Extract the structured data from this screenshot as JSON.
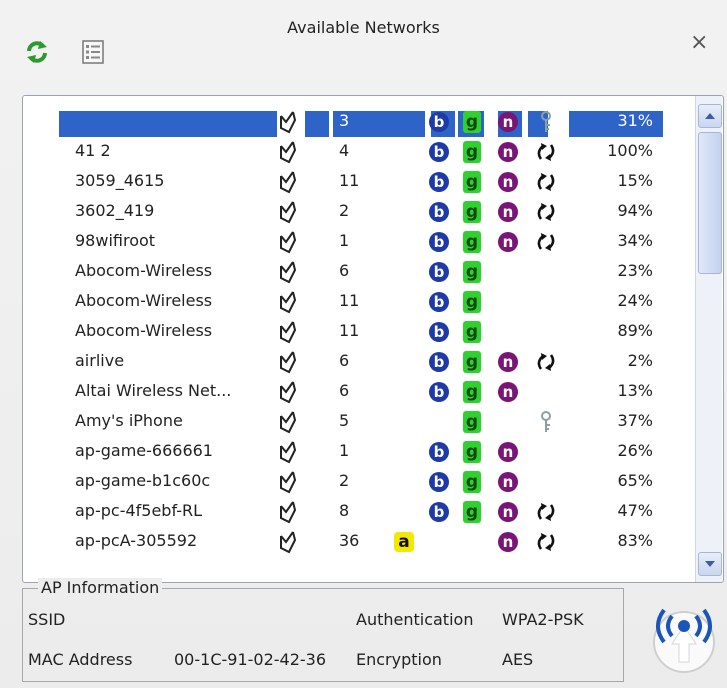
{
  "window": {
    "title": "Available Networks",
    "close": "×"
  },
  "networks": [
    {
      "ssid": "",
      "ch": "3",
      "b": true,
      "g": true,
      "n": true,
      "a": false,
      "enc": "key",
      "sig": "31%",
      "selected": true
    },
    {
      "ssid": "41 2",
      "ch": "4",
      "b": true,
      "g": true,
      "n": true,
      "a": false,
      "enc": "arrows",
      "sig": "100%"
    },
    {
      "ssid": "3059_4615",
      "ch": "11",
      "b": true,
      "g": true,
      "n": true,
      "a": false,
      "enc": "arrows",
      "sig": "15%"
    },
    {
      "ssid": "3602_419",
      "ch": "2",
      "b": true,
      "g": true,
      "n": true,
      "a": false,
      "enc": "arrows",
      "sig": "94%"
    },
    {
      "ssid": "98wifiroot",
      "ch": "1",
      "b": true,
      "g": true,
      "n": true,
      "a": false,
      "enc": "arrows",
      "sig": "34%"
    },
    {
      "ssid": "Abocom-Wireless",
      "ch": "6",
      "b": true,
      "g": true,
      "n": false,
      "a": false,
      "enc": "",
      "sig": "23%"
    },
    {
      "ssid": "Abocom-Wireless",
      "ch": "11",
      "b": true,
      "g": true,
      "n": false,
      "a": false,
      "enc": "",
      "sig": "24%"
    },
    {
      "ssid": "Abocom-Wireless",
      "ch": "11",
      "b": true,
      "g": true,
      "n": false,
      "a": false,
      "enc": "",
      "sig": "89%"
    },
    {
      "ssid": "airlive",
      "ch": "6",
      "b": true,
      "g": true,
      "n": true,
      "a": false,
      "enc": "arrows",
      "sig": "2%"
    },
    {
      "ssid": "Altai Wireless Net...",
      "ch": "6",
      "b": true,
      "g": true,
      "n": true,
      "a": false,
      "enc": "",
      "sig": "13%"
    },
    {
      "ssid": "Amy's iPhone",
      "ch": "5",
      "b": false,
      "g": true,
      "n": false,
      "a": false,
      "enc": "key",
      "sig": "37%"
    },
    {
      "ssid": "ap-game-666661",
      "ch": "1",
      "b": true,
      "g": true,
      "n": true,
      "a": false,
      "enc": "",
      "sig": "26%"
    },
    {
      "ssid": "ap-game-b1c60c",
      "ch": "2",
      "b": true,
      "g": true,
      "n": true,
      "a": false,
      "enc": "",
      "sig": "65%"
    },
    {
      "ssid": "ap-pc-4f5ebf-RL",
      "ch": "8",
      "b": true,
      "g": true,
      "n": true,
      "a": false,
      "enc": "arrows",
      "sig": "47%"
    },
    {
      "ssid": "ap-pcA-305592",
      "ch": "36",
      "b": false,
      "g": false,
      "n": true,
      "a": true,
      "enc": "arrows",
      "sig": "83%"
    }
  ],
  "ap_info": {
    "legend": "AP Information",
    "ssid_label": "SSID",
    "mac_label": "MAC Address",
    "mac_value": "00-1C-91-02-42-36",
    "auth_label": "Authentication",
    "auth_value": "WPA2-PSK",
    "enc_label": "Encryption",
    "enc_value": "AES"
  },
  "colors": {
    "b": "#1d3aa8",
    "g": "#2fd12f",
    "n": "#7a1578",
    "a": "#f2e800",
    "selection": "#2e64c8"
  },
  "icons": [
    "refresh-icon",
    "list-view-icon",
    "infrastructure-icon",
    "key-icon",
    "arrows-icon",
    "wifi-signal-icon"
  ]
}
